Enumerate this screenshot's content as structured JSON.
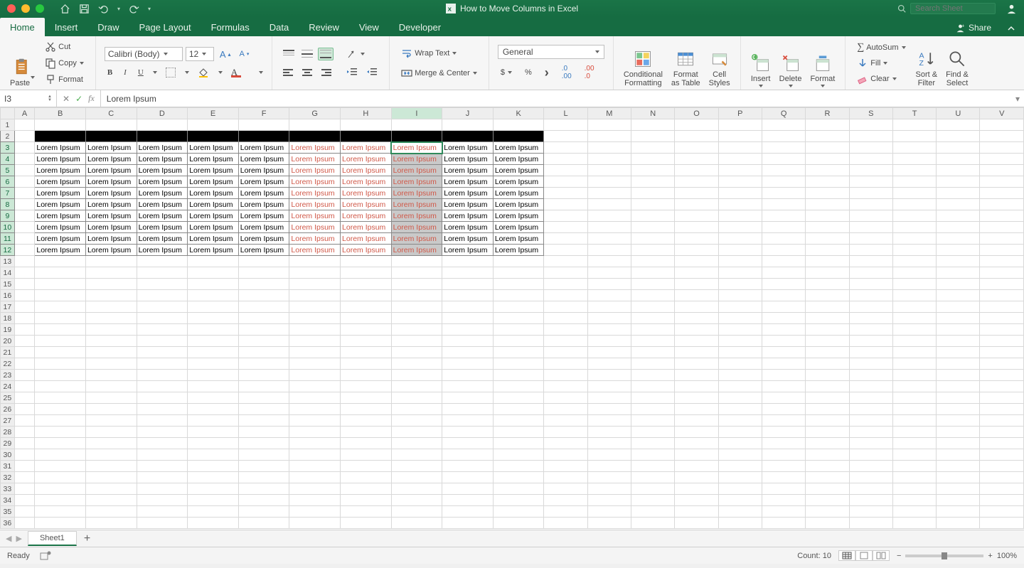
{
  "titlebar": {
    "title": "How to Move Columns in Excel",
    "search_placeholder": "Search Sheet"
  },
  "tabs": {
    "items": [
      "Home",
      "Insert",
      "Draw",
      "Page Layout",
      "Formulas",
      "Data",
      "Review",
      "View",
      "Developer"
    ],
    "active": 0,
    "share": "Share"
  },
  "ribbon": {
    "paste": "Paste",
    "cut": "Cut",
    "copy": "Copy",
    "format_p": "Format",
    "font_name": "Calibri (Body)",
    "font_size": "12",
    "wrap": "Wrap Text",
    "merge": "Merge & Center",
    "numfmt": "General",
    "cond": "Conditional\nFormatting",
    "fmt_tbl": "Format\nas Table",
    "styles": "Cell\nStyles",
    "insert": "Insert",
    "delete": "Delete",
    "format": "Format",
    "autosum": "AutoSum",
    "fill": "Fill",
    "clear": "Clear",
    "sort": "Sort &\nFilter",
    "find": "Find &\nSelect"
  },
  "formula": {
    "ref": "I3",
    "value": "Lorem Ipsum"
  },
  "columns": [
    "A",
    "B",
    "C",
    "D",
    "E",
    "F",
    "G",
    "H",
    "I",
    "J",
    "K",
    "L",
    "M",
    "N",
    "O",
    "P",
    "Q",
    "R",
    "S",
    "T",
    "U",
    "V"
  ],
  "selected_col_index": 8,
  "row_count": 36,
  "data": {
    "rows_start": 3,
    "rows_end": 12,
    "cols_start": 1,
    "cols_end": 10,
    "cell_text": "Lorem Ipsum",
    "black_row": 2,
    "red_cols": [
      6,
      7,
      8
    ],
    "gray_col": 8
  },
  "sheet": {
    "name": "Sheet1"
  },
  "status": {
    "mode": "Ready",
    "count_label": "Count:",
    "count": 10,
    "zoom": "100%"
  }
}
